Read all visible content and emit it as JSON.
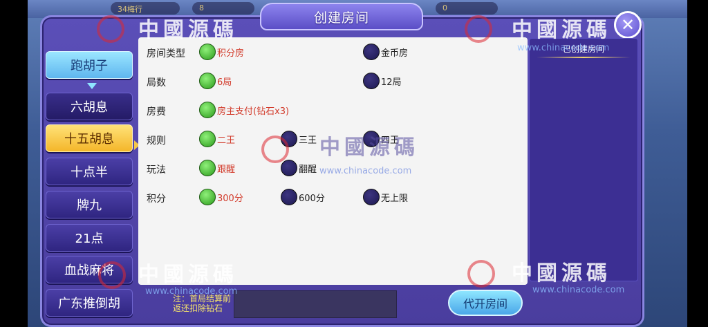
{
  "topbar": {
    "left_value": "34梅行",
    "gold_value": "8",
    "diamond_value": "0"
  },
  "dialog": {
    "title": "创建房间",
    "close_icon": "close-icon"
  },
  "left_menu": {
    "items": [
      {
        "label": "跑胡子",
        "style": "blue"
      },
      {
        "label": "六胡息",
        "style": "dark"
      },
      {
        "label": "十五胡息",
        "style": "yellow"
      },
      {
        "label": "十点半",
        "style": "normal"
      },
      {
        "label": "牌九",
        "style": "normal"
      },
      {
        "label": "21点",
        "style": "normal"
      },
      {
        "label": "血战麻将",
        "style": "normal"
      },
      {
        "label": "广东推倒胡",
        "style": "normal"
      }
    ]
  },
  "settings": {
    "room_type": {
      "label": "房间类型",
      "options": [
        {
          "label": "积分房",
          "selected": true
        },
        {
          "label": "金币房",
          "selected": false
        }
      ]
    },
    "rounds": {
      "label": "局数",
      "options": [
        {
          "label": "6局",
          "selected": true
        },
        {
          "label": "12局",
          "selected": false
        }
      ]
    },
    "fee": {
      "label": "房费",
      "options": [
        {
          "label": "房主支付(钻石x3)",
          "selected": true
        }
      ]
    },
    "rules": {
      "label": "规则",
      "options": [
        {
          "label": "二王",
          "selected": true
        },
        {
          "label": "三王",
          "selected": false
        },
        {
          "label": "四王",
          "selected": false
        }
      ]
    },
    "play": {
      "label": "玩法",
      "options": [
        {
          "label": "跟醒",
          "selected": true
        },
        {
          "label": "翻醒",
          "selected": false
        }
      ]
    },
    "score": {
      "label": "积分",
      "options": [
        {
          "label": "300分",
          "selected": true
        },
        {
          "label": "600分",
          "selected": false
        },
        {
          "label": "无上限",
          "selected": false
        }
      ]
    }
  },
  "right_panel": {
    "header": "已创建房间"
  },
  "footer": {
    "note_line1": "注：首局结算前",
    "note_line2": "返还扣除钻石",
    "proxy_button": "代开房间"
  },
  "watermark": {
    "text": "中國源碼",
    "url": "www.chinacode.com"
  },
  "colors": {
    "accent_purple": "#5b4fb8",
    "selected_green": "#2a9a1a",
    "selected_text": "#d23a2a",
    "tab_yellow": "#f4b62a",
    "tab_blue": "#5fb6ef"
  }
}
